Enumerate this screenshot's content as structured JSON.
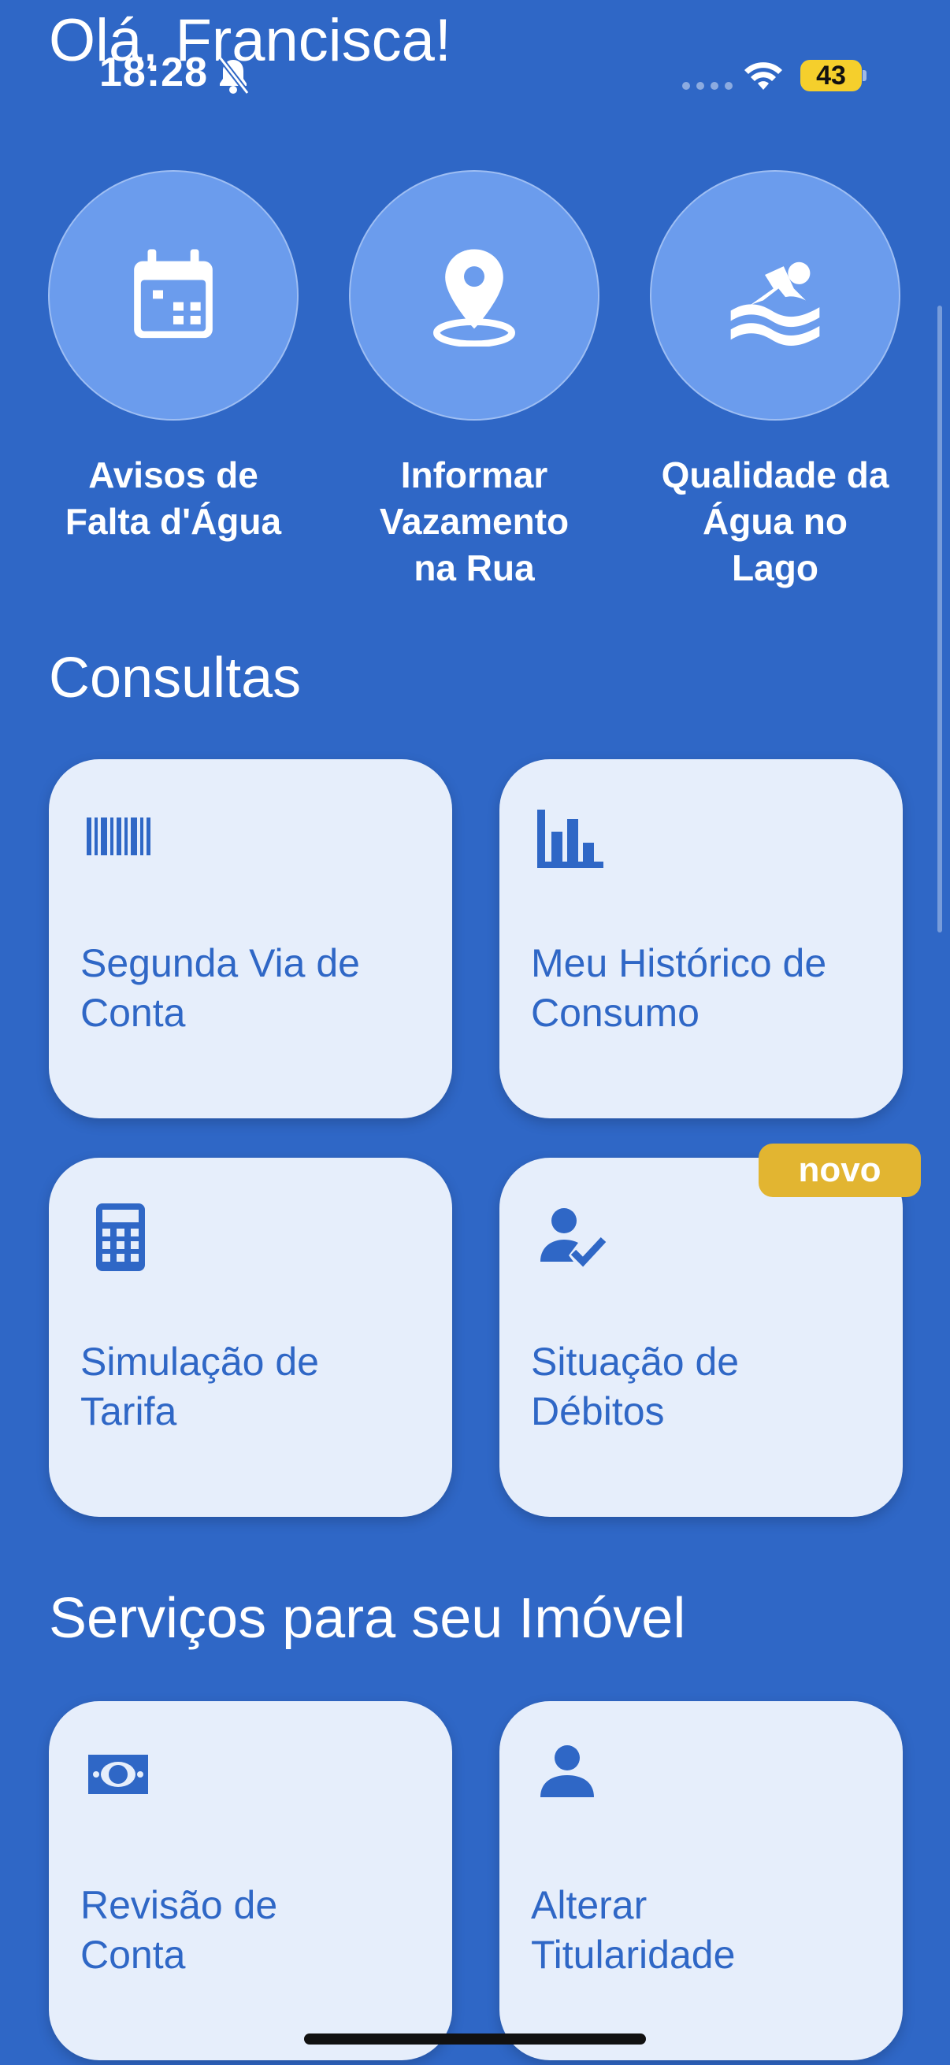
{
  "header": {
    "greeting": "Olá, Francisca!"
  },
  "status_bar": {
    "time": "18:28",
    "battery": "43",
    "icons": [
      "bell-slash-icon",
      "signal-icon",
      "wifi-icon",
      "battery-icon"
    ]
  },
  "quick_actions": [
    {
      "label_lines": [
        "Avisos de",
        "Falta d'Água"
      ],
      "icon": "calendar-icon"
    },
    {
      "label_lines": [
        "Informar",
        "Vazamento",
        "na Rua"
      ],
      "icon": "location-pin-icon"
    },
    {
      "label_lines": [
        "Qualidade da",
        "Água no",
        "Lago"
      ],
      "icon": "swimmer-icon"
    }
  ],
  "sections": {
    "consultas": {
      "title": "Consultas",
      "cards": [
        {
          "label_lines": [
            "Segunda Via de",
            "Conta"
          ],
          "icon": "barcode-icon"
        },
        {
          "label_lines": [
            "Meu Histórico de",
            "Consumo"
          ],
          "icon": "bar-chart-icon"
        },
        {
          "label_lines": [
            "Simulação de",
            "Tarifa"
          ],
          "icon": "calculator-icon"
        },
        {
          "label_lines": [
            "Situação de",
            "Débitos"
          ],
          "icon": "person-check-icon",
          "badge": "novo"
        }
      ]
    },
    "servicos": {
      "title": "Serviços para seu Imóvel",
      "cards": [
        {
          "label_lines": [
            "Revisão de",
            "Conta"
          ],
          "icon": "money-bill-icon"
        },
        {
          "label_lines": [
            "Alterar",
            "Titularidade"
          ],
          "icon": "person-icon"
        }
      ]
    }
  },
  "colors": {
    "background": "#2f67c6",
    "circle": "#6b9ced",
    "card": "#e6eefb",
    "card_text": "#2f67c6",
    "badge": "#e2b531"
  }
}
